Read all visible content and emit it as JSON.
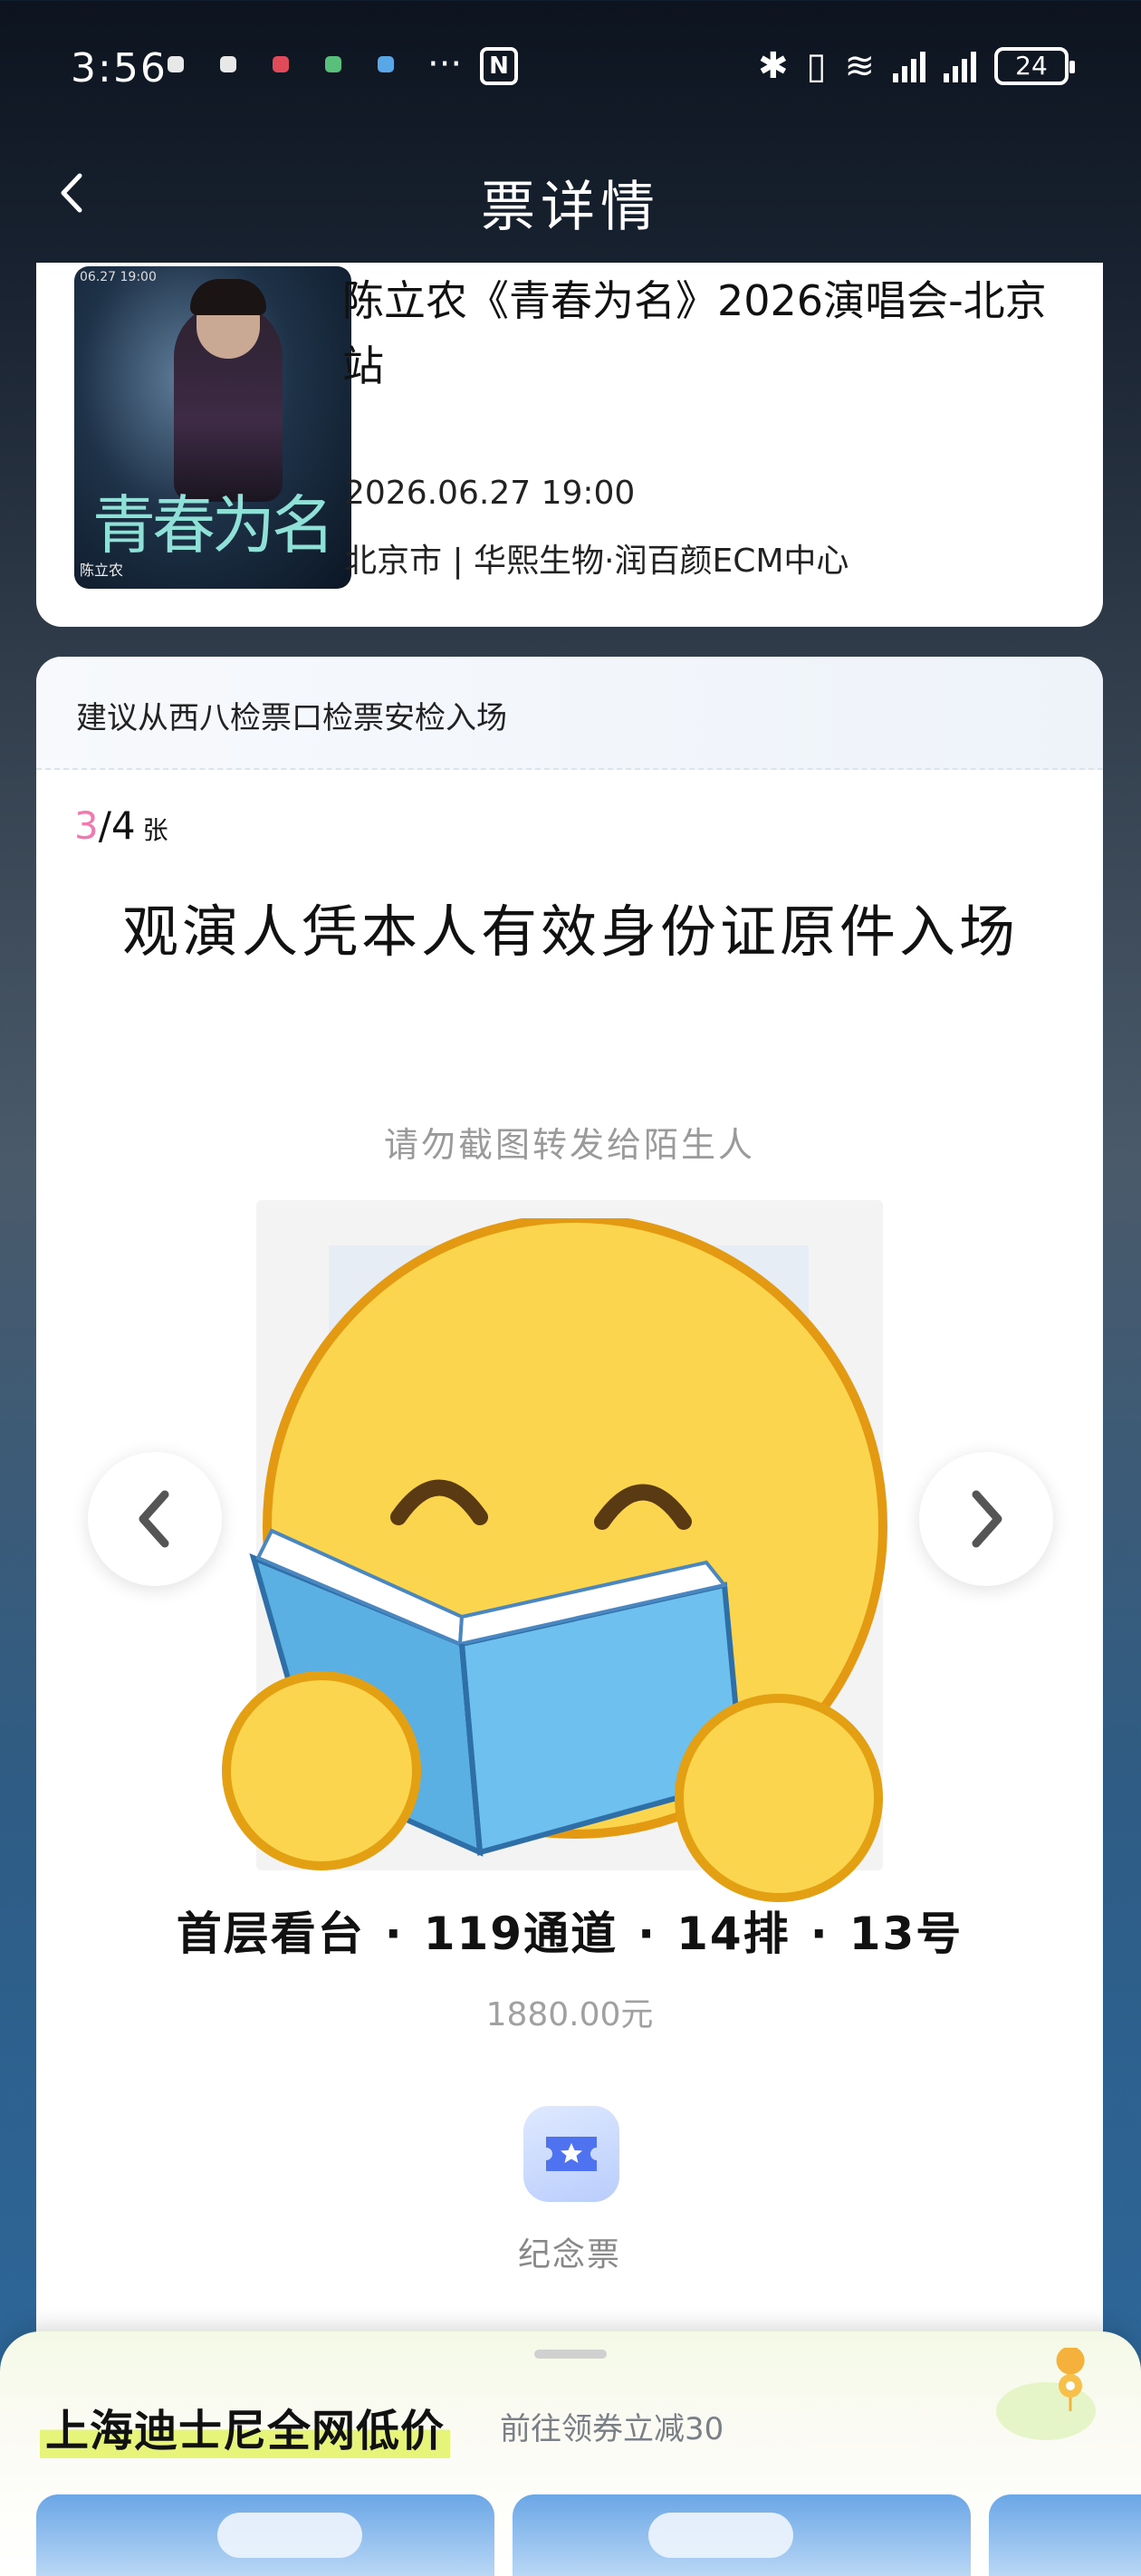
{
  "status_bar": {
    "time": "3:56",
    "more": "···",
    "nfc": "N",
    "battery": "24"
  },
  "header": {
    "title": "票详情"
  },
  "event": {
    "title": "陈立农《青春为名》2026演唱会-北京站",
    "datetime": "2026.06.27 19:00",
    "venue": "北京市 | 华熙生物·润百颜ECM中心",
    "poster": {
      "text": "青春为名",
      "date": "06.27 19:00",
      "names": "陈立农"
    }
  },
  "ticket": {
    "entry_tip": "建议从西八检票口检票安检入场",
    "count_current": "3",
    "count_total": "/4",
    "count_unit": "张",
    "id_notice": "观演人凭本人有效身份证原件入场",
    "no_share_notice": "请勿截图转发给陌生人",
    "seat": {
      "section": "首层看台",
      "gate": "119通道",
      "row": "14排",
      "number": "13号",
      "separator": "·"
    },
    "price": "1880.00元",
    "souvenir_label": "纪念票"
  },
  "promo": {
    "title": "上海迪士尼全网低价",
    "subtitle": "前往领券立减30"
  },
  "colors": {
    "accent_pink": "#f07ab0",
    "highlight": "#e6f57a",
    "souvenir": "#b9cdfc"
  }
}
